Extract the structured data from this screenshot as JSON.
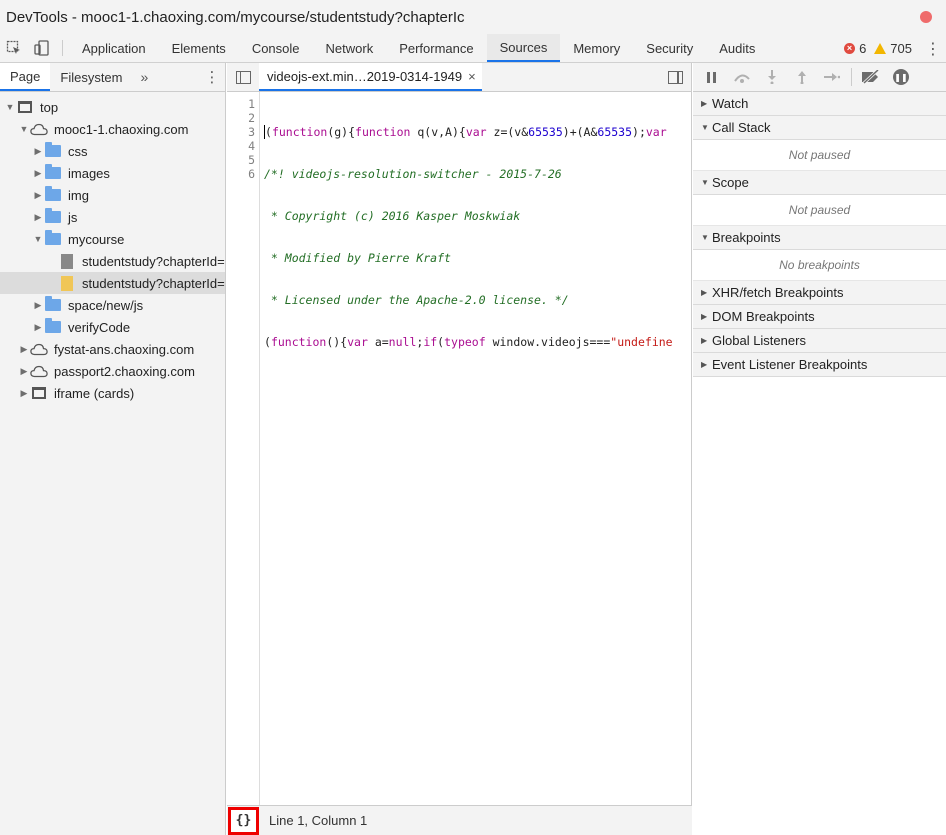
{
  "window": {
    "title": "DevTools - mooc1-1.chaoxing.com/mycourse/studentstudy?chapterIc"
  },
  "toolbar": {
    "tabs": [
      "Application",
      "Elements",
      "Console",
      "Network",
      "Performance",
      "Sources",
      "Memory",
      "Security",
      "Audits"
    ],
    "active_tab": "Sources",
    "errors_count": "6",
    "warnings_count": "705"
  },
  "navigator": {
    "tabs": [
      "Page",
      "Filesystem"
    ],
    "more": "»",
    "tree": [
      {
        "label": "top",
        "depth": 0,
        "arrow": "▼",
        "icon": "frame-icon"
      },
      {
        "label": "mooc1-1.chaoxing.com",
        "depth": 1,
        "arrow": "▼",
        "icon": "cloud-icon"
      },
      {
        "label": "css",
        "depth": 2,
        "arrow": "▶",
        "icon": "folder-icon"
      },
      {
        "label": "images",
        "depth": 2,
        "arrow": "▶",
        "icon": "folder-icon"
      },
      {
        "label": "img",
        "depth": 2,
        "arrow": "▶",
        "icon": "folder-icon"
      },
      {
        "label": "js",
        "depth": 2,
        "arrow": "▶",
        "icon": "folder-icon"
      },
      {
        "label": "mycourse",
        "depth": 2,
        "arrow": "▼",
        "icon": "folder-icon"
      },
      {
        "label": "studentstudy?chapterId=",
        "depth": 3,
        "arrow": "",
        "icon": "file-icon"
      },
      {
        "label": "studentstudy?chapterId=",
        "depth": 3,
        "arrow": "",
        "icon": "file-yellow-icon",
        "selected": true
      },
      {
        "label": "space/new/js",
        "depth": 2,
        "arrow": "▶",
        "icon": "folder-icon"
      },
      {
        "label": "verifyCode",
        "depth": 2,
        "arrow": "▶",
        "icon": "folder-icon"
      },
      {
        "label": "fystat-ans.chaoxing.com",
        "depth": 1,
        "arrow": "▶",
        "icon": "cloud-icon"
      },
      {
        "label": "passport2.chaoxing.com",
        "depth": 1,
        "arrow": "▶",
        "icon": "cloud-icon"
      },
      {
        "label": "iframe (cards)",
        "depth": 1,
        "arrow": "▶",
        "icon": "frame-icon"
      }
    ]
  },
  "editor": {
    "file_tab": "videojs-ext.min…2019-0314-1949",
    "close_glyph": "×",
    "line_numbers": [
      "1",
      "2",
      "3",
      "4",
      "5",
      "6"
    ],
    "code": {
      "line1_p1": "(",
      "line1_kw1": "function",
      "line1_p2": "(g){",
      "line1_kw2": "function",
      "line1_p3": " q(v,A){",
      "line1_kw3": "var",
      "line1_p4": " z=(v&",
      "line1_num1": "65535",
      "line1_p5": ")+(A&",
      "line1_num2": "65535",
      "line1_p6": ");",
      "line1_kw4": "var",
      "line2": "/*! videojs-resolution-switcher - 2015-7-26",
      "line3": " * Copyright (c) 2016 Kasper Moskwiak",
      "line4": " * Modified by Pierre Kraft",
      "line5": " * Licensed under the Apache-2.0 license. */",
      "line6_p1": "(",
      "line6_kw1": "function",
      "line6_p2": "(){",
      "line6_kw2": "var",
      "line6_p3": " a=",
      "line6_kw3": "null",
      "line6_p4": ";",
      "line6_kw4": "if",
      "line6_p5": "(",
      "line6_kw5": "typeof",
      "line6_p6": " window.videojs===",
      "line6_str": "\"undefine"
    },
    "pretty_print_label": "{}",
    "status": "Line 1, Column 1"
  },
  "debugger": {
    "sections": [
      {
        "title": "Watch",
        "expanded": false,
        "body": ""
      },
      {
        "title": "Call Stack",
        "expanded": true,
        "body": "Not paused"
      },
      {
        "title": "Scope",
        "expanded": true,
        "body": "Not paused"
      },
      {
        "title": "Breakpoints",
        "expanded": true,
        "body": "No breakpoints"
      },
      {
        "title": "XHR/fetch Breakpoints",
        "expanded": false,
        "body": ""
      },
      {
        "title": "DOM Breakpoints",
        "expanded": false,
        "body": ""
      },
      {
        "title": "Global Listeners",
        "expanded": false,
        "body": ""
      },
      {
        "title": "Event Listener Breakpoints",
        "expanded": false,
        "body": ""
      }
    ]
  }
}
